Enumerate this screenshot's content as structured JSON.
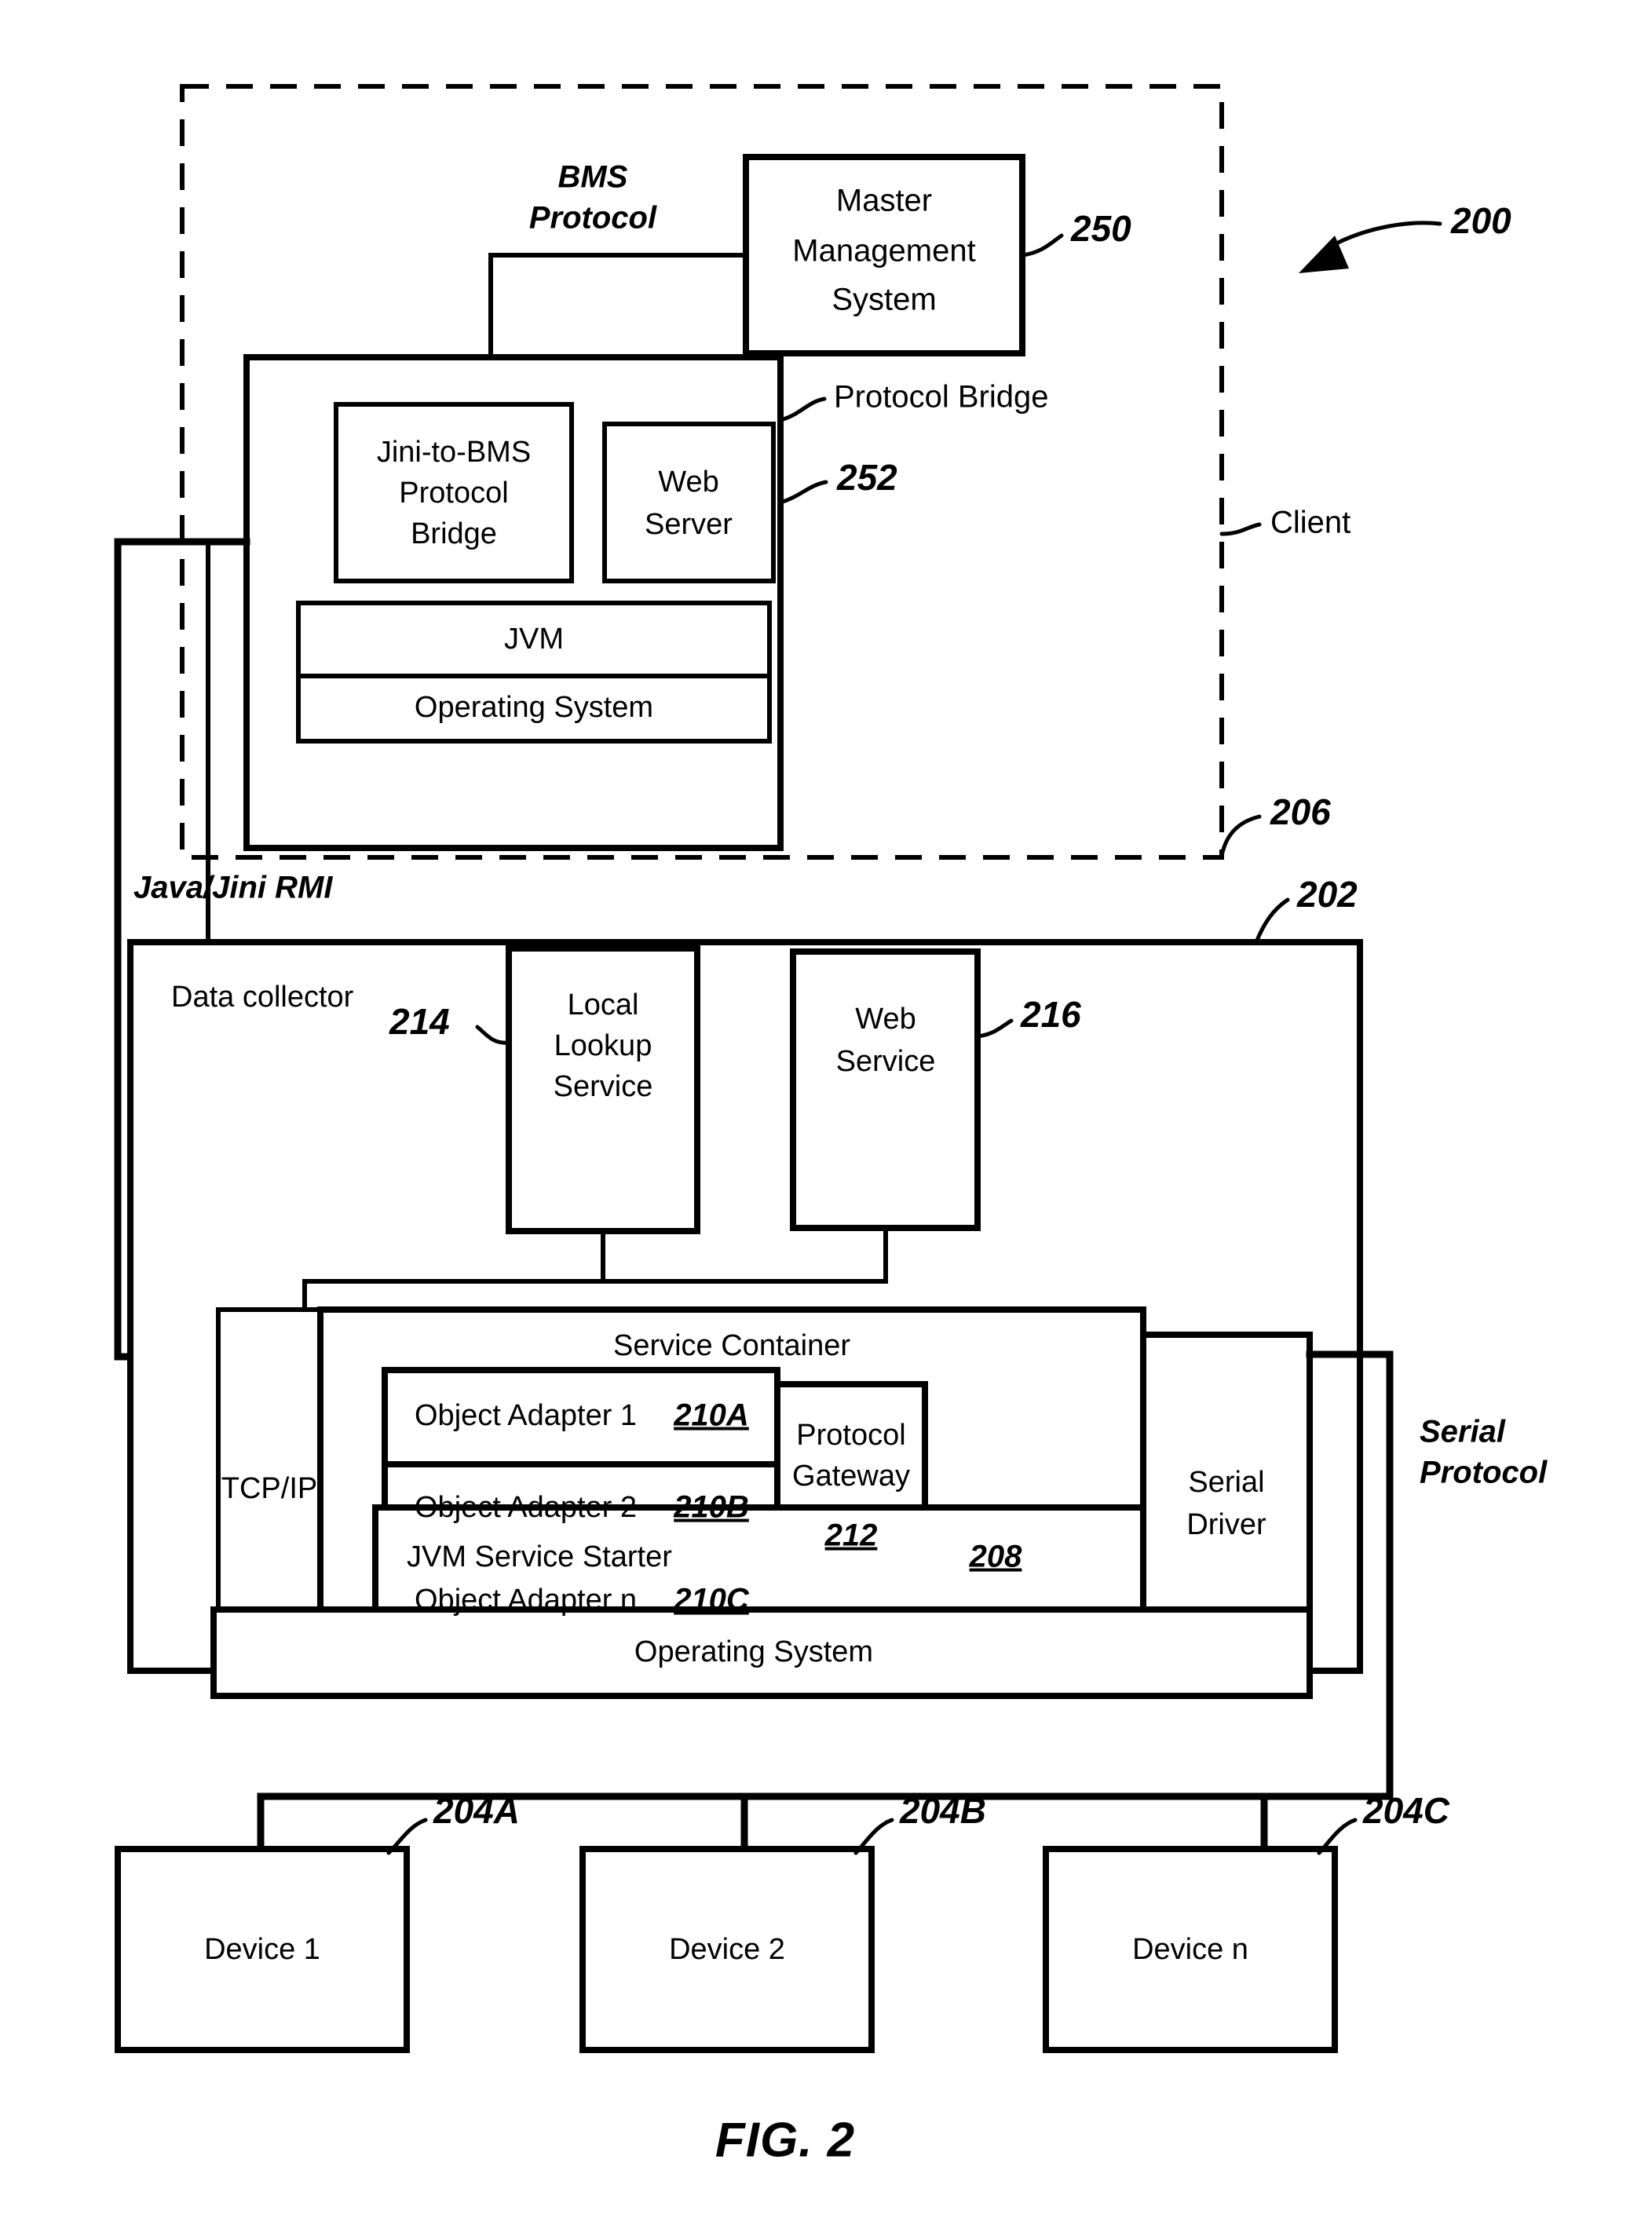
{
  "figure": {
    "caption": "FIG. 2",
    "system_ref": "200"
  },
  "client_zone": {
    "label": "Client",
    "ref": "206"
  },
  "master_management_system": {
    "label_line1": "Master",
    "label_line2": "Management",
    "label_line3": "System",
    "ref": "250"
  },
  "protocol_bridge_host": {
    "label": "Protocol Bridge",
    "ref": "252",
    "children": {
      "jini_bridge": {
        "line1": "Jini-to-BMS",
        "line2": "Protocol",
        "line3": "Bridge"
      },
      "web_server": {
        "line1": "Web",
        "line2": "Server"
      },
      "jvm": "JVM",
      "operating_system": "Operating System"
    }
  },
  "connections": {
    "bms_protocol_line1": "BMS",
    "bms_protocol_line2": "Protocol",
    "java_jini_rmi": "Java/Jini RMI",
    "serial_protocol_line1": "Serial",
    "serial_protocol_line2": "Protocol"
  },
  "data_collector": {
    "label": "Data collector",
    "ref": "202",
    "local_lookup_service": {
      "line1": "Local",
      "line2": "Lookup",
      "line3": "Service",
      "ref": "214"
    },
    "web_service": {
      "line1": "Web",
      "line2": "Service",
      "ref": "216"
    },
    "tcp_ip": "TCP/IP",
    "service_container": {
      "label": "Service Container",
      "object_adapters": [
        {
          "name": "Object Adapter 1",
          "ref": "210A"
        },
        {
          "name": "Object Adapter 2",
          "ref": "210B"
        },
        {
          "name": "Object Adapter n",
          "ref": "210C"
        }
      ],
      "protocol_gateway": {
        "line1": "Protocol",
        "line2": "Gateway",
        "ref": "212"
      }
    },
    "jvm_service_starter": {
      "label": "JVM Service Starter",
      "ref": "208"
    },
    "operating_system": "Operating System",
    "serial_driver": {
      "line1": "Serial",
      "line2": "Driver"
    }
  },
  "devices": [
    {
      "label": "Device 1",
      "ref": "204A"
    },
    {
      "label": "Device 2",
      "ref": "204B"
    },
    {
      "label": "Device n",
      "ref": "204C"
    }
  ]
}
